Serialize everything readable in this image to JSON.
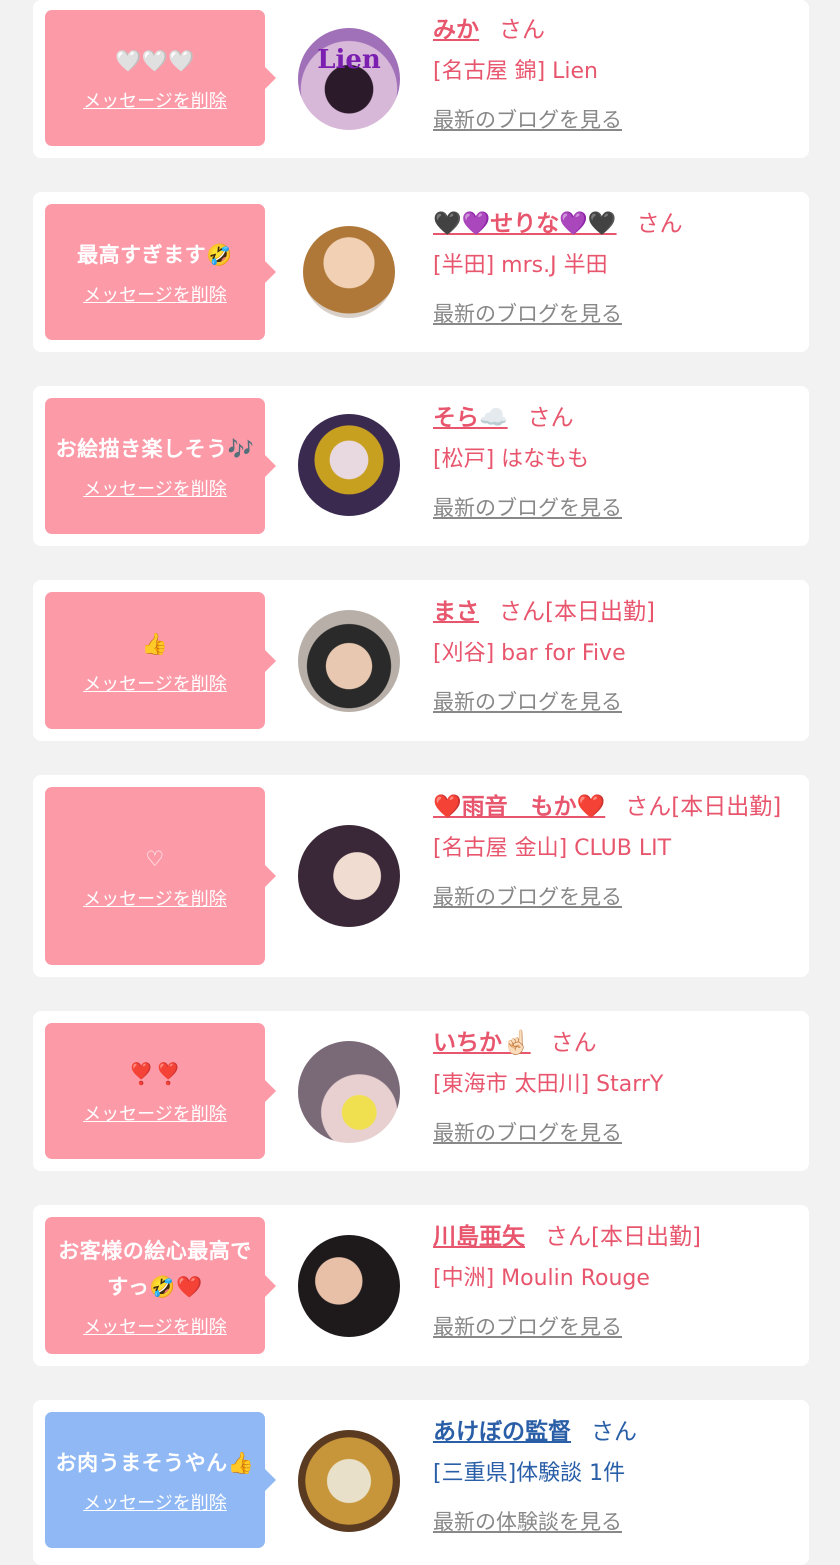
{
  "delete_label": "メッセージを削除",
  "items": [
    {
      "message": "🤍🤍🤍",
      "name": "みか",
      "suffix": "さん",
      "shop": "[名古屋 錦] Lien",
      "blog": "最新のブログを見る"
    },
    {
      "message": "最高すぎます🤣",
      "name": "🖤💜せりな💜🖤",
      "suffix": "さん",
      "shop": "[半田] mrs.J 半田",
      "blog": "最新のブログを見る"
    },
    {
      "message": "お絵描き楽しそう🎶",
      "name": "そら☁️",
      "suffix": "さん",
      "shop": "[松戸] はなもも",
      "blog": "最新のブログを見る"
    },
    {
      "message": "👍",
      "name": "まさ",
      "suffix": "さん[本日出勤]",
      "shop": "[刈谷] bar for Five",
      "blog": "最新のブログを見る"
    },
    {
      "message": "♡",
      "name": "❤️雨音　もか❤️",
      "suffix": "さん[本日出勤]",
      "shop": "[名古屋 金山] CLUB LIT",
      "blog": "最新のブログを見る"
    },
    {
      "message": "❣️❣️",
      "name": "いちか☝🏻",
      "suffix": "さん",
      "shop": "[東海市 太田川] StarrY",
      "blog": "最新のブログを見る"
    },
    {
      "message": "お客様の絵心最高ですっ🤣❤️",
      "name": "川島亜矢",
      "suffix": "さん[本日出勤]",
      "shop": "[中洲] Moulin Rouge",
      "blog": "最新のブログを見る"
    },
    {
      "message": "お肉うまそうやん👍",
      "name": "あけぼの監督",
      "suffix": "さん",
      "shop": "[三重県]体験談 1件",
      "blog": "最新の体験談を見る"
    }
  ]
}
